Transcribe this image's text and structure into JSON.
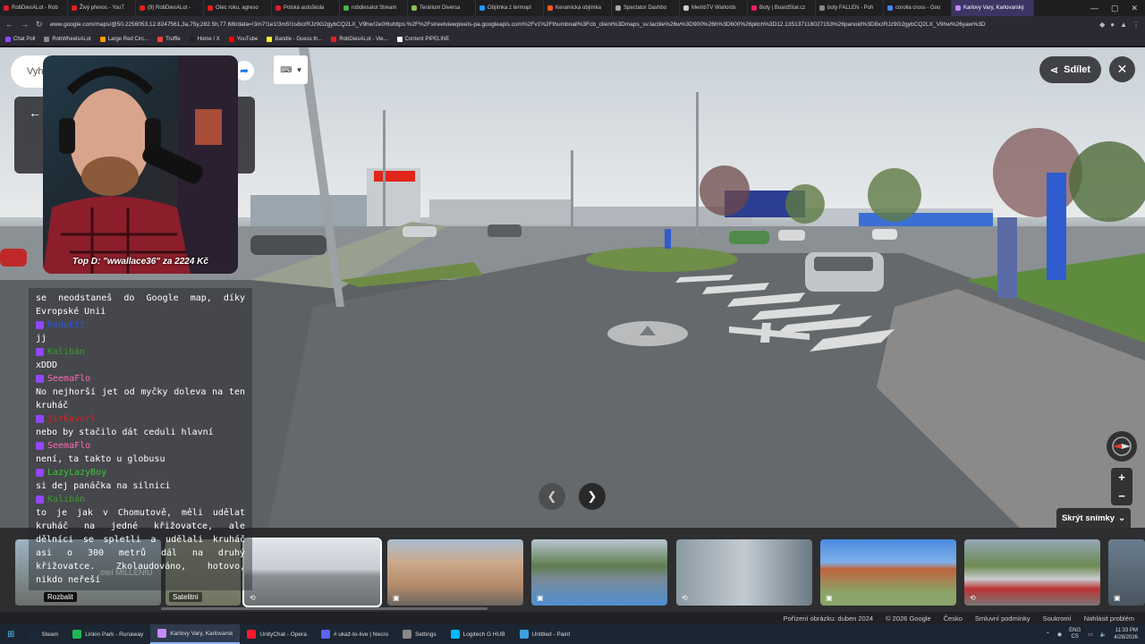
{
  "browser": {
    "tabs": [
      {
        "label": "RobDiesALot - Rob",
        "color": "#e02020"
      },
      {
        "label": "Živý přenos - YouT",
        "color": "#e02020"
      },
      {
        "label": "(9) RobDiesALot -",
        "color": "#e02020"
      },
      {
        "label": "Otec roku, agreso",
        "color": "#e02020"
      },
      {
        "label": "Polská autoškola",
        "color": "#e02020"
      },
      {
        "label": "robdiesalot Stream",
        "color": "#4caf50"
      },
      {
        "label": "Terárium Diversa",
        "color": "#8bc34a"
      },
      {
        "label": "Objímka z termopl",
        "color": "#2196f3"
      },
      {
        "label": "Keramická objímka",
        "color": "#ff5722"
      },
      {
        "label": "Spectator Dashbo",
        "color": "#aaaaaa"
      },
      {
        "label": "MembTV Warlords",
        "color": "#cccccc"
      },
      {
        "label": "Boty | BoardStar.cz",
        "color": "#e91e63"
      },
      {
        "label": "boty FALLEN - Poh",
        "color": "#888888"
      },
      {
        "label": "corolla cross - Goo",
        "color": "#4285f4"
      },
      {
        "label": "Karlovy Vary, Karlovarský",
        "color": "#c58af9",
        "active": true
      }
    ],
    "url": "www.google.com/maps/@50.2256053,12.8247561,3a,75y,282.5h,77.68t/data=!3m7!1e1!3m5!1s8xzRJz9G2gybCQ2LX_V9hw!2e0!6shttps:%2F%2Fstreetviewpixels-pa.googleapis.com%2Fv1%2Fthumbnail%3Fcb_client%3Dmaps_sv.tactile%26w%3D900%26h%3D600%26pitch%3D12.135137118027153%26panoid%3D8xzRJz9G2gybCQ2LX_V9hw%26yaw%3D",
    "bookmarks": [
      {
        "label": "Chat Poll",
        "color": "#9147ff"
      },
      {
        "label": "RobWheelsALot",
        "color": "#888888"
      },
      {
        "label": "Large Red Circ...",
        "color": "#ff9800"
      },
      {
        "label": "Truffle",
        "color": "#f44336"
      },
      {
        "label": "Home / X",
        "color": "#222222"
      },
      {
        "label": "YouTube",
        "color": "#ff0000"
      },
      {
        "label": "Bandle - Guess th...",
        "color": "#ffeb3b"
      },
      {
        "label": "RobDiesALot - Vie...",
        "color": "#e02020"
      },
      {
        "label": "Content PIPELINE",
        "color": "#ffffff"
      }
    ]
  },
  "webcam": {
    "caption": "Top D: \"wwallace36\" za 2224 Kč"
  },
  "chat": [
    {
      "user": "",
      "text": "se neodstaneš do Google map, díky Evropské Unii",
      "color": "#ffffff"
    },
    {
      "user": "Reduktt",
      "text": "jj",
      "color": "#2f54eb"
    },
    {
      "user": "Kalibán",
      "text": "xDDD",
      "color": "#3d9b2f"
    },
    {
      "user": "SeemaFlo",
      "text": "No nejhorší jet od myčky doleva na ten kruháč",
      "color": "#ff69b4"
    },
    {
      "user": "jirkavorl",
      "text": "nebo by stačilo dát ceduli hlavní",
      "color": "#e02020"
    },
    {
      "user": "SeemaFlo",
      "text": "není, ta takto u globusu",
      "color": "#ff69b4"
    },
    {
      "user": "LazyLazyBoy",
      "text": "si dej panáčka na silnici",
      "color": "#32cd32"
    },
    {
      "user": "Kalibán",
      "text": "to je jak v Chomutově, měli udělat kruháč na jedné křižovatce, ale dělníci se spletli a udělali kruháč asi o 300 metrů dál na druhý křižovatce. Zkolaudováno, hotovo, nikdo neřeší",
      "color": "#3d9b2f"
    }
  ],
  "maps": {
    "search_placeholder": "Vyh",
    "share_label": "Sdílet",
    "hide_shots_label": "Skrýt snímky",
    "expand_label": "Rozbalit",
    "satellite_label": "Satelitní",
    "overlay_text": "otel MILLENIU",
    "zoom_in": "+",
    "zoom_out": "−"
  },
  "footer": {
    "capture_date": "Pořízení obrázku: duben 2024",
    "copyright": "© 2026 Google",
    "country": "Česko",
    "terms": "Smluvní podmínky",
    "privacy": "Soukromí",
    "report": "Nahlásit problém"
  },
  "taskbar": {
    "items": [
      {
        "label": "Steam",
        "color": "#1b2838"
      },
      {
        "label": "Linkin Park - Runaway",
        "color": "#1db954"
      },
      {
        "label": "Karlovy Vary, Karlovarsk",
        "color": "#c58af9",
        "active": true
      },
      {
        "label": "UnityChat - Opera",
        "color": "#ff1b2d"
      },
      {
        "label": "# ukaž-to-live | Necro",
        "color": "#5865f2"
      },
      {
        "label": "Settings",
        "color": "#888888"
      },
      {
        "label": "Logitech G HUB",
        "color": "#00b8fc"
      },
      {
        "label": "Untitled - Paint",
        "color": "#3aa0e0"
      }
    ],
    "lang": "ENG",
    "lang2": "CS",
    "time": "11:33 PM",
    "date": "4/28/2026"
  }
}
